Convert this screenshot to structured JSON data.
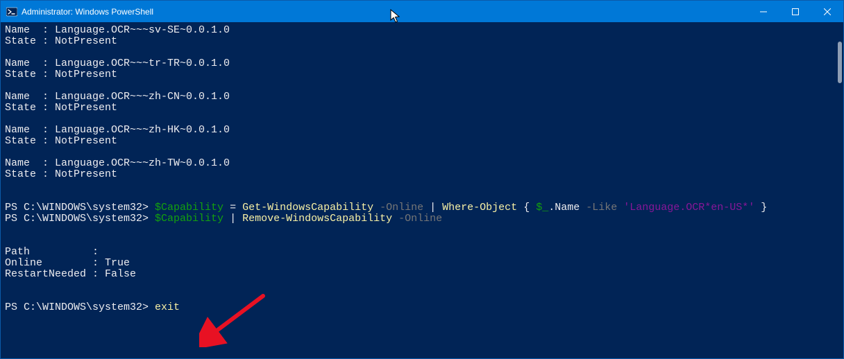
{
  "titlebar": {
    "title": "Administrator: Windows PowerShell"
  },
  "capabilities": [
    {
      "name": "Language.OCR~~~sv-SE~0.0.1.0",
      "state": "NotPresent"
    },
    {
      "name": "Language.OCR~~~tr-TR~0.0.1.0",
      "state": "NotPresent"
    },
    {
      "name": "Language.OCR~~~zh-CN~0.0.1.0",
      "state": "NotPresent"
    },
    {
      "name": "Language.OCR~~~zh-HK~0.0.1.0",
      "state": "NotPresent"
    },
    {
      "name": "Language.OCR~~~zh-TW~0.0.1.0",
      "state": "NotPresent"
    }
  ],
  "prompt": "PS C:\\WINDOWS\\system32> ",
  "cmd1": {
    "var": "$Capability",
    "eq": " = ",
    "cmd": "Get-WindowsCapability",
    "param": " -Online",
    "pipe": " | ",
    "where": "Where-Object",
    "brace_open": " { ",
    "dollar_under": "$_",
    "dot_name": ".Name",
    "like": " -Like ",
    "pattern": "'Language.OCR*en-US*'",
    "brace_close": " }"
  },
  "cmd2": {
    "var": "$Capability",
    "pipe": " | ",
    "cmd": "Remove-WindowsCapability",
    "param": " -Online"
  },
  "result": {
    "path_label": "Path          :",
    "online_label": "Online        : ",
    "online_value": "True",
    "restart_label": "RestartNeeded : ",
    "restart_value": "False"
  },
  "cmd3": {
    "text": "exit"
  },
  "labels": {
    "name": "Name  : ",
    "state": "State : "
  }
}
